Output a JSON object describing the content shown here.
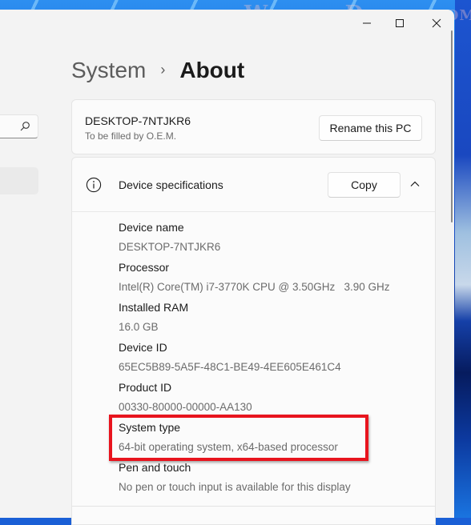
{
  "watermark": "WindowsDigital.com",
  "window": {
    "caption_buttons": [
      "minimize",
      "maximize",
      "close"
    ]
  },
  "sidebar": {
    "search_placeholder": ""
  },
  "breadcrumb": {
    "parent": "System",
    "separator": "›",
    "current": "About"
  },
  "pc_card": {
    "device_name": "DESKTOP-7NTJKR6",
    "model": "To be filled by O.E.M.",
    "rename_button": "Rename this PC"
  },
  "device_specifications": {
    "title": "Device specifications",
    "copy_button": "Copy",
    "expanded": true,
    "items": [
      {
        "label": "Device name",
        "value": "DESKTOP-7NTJKR6"
      },
      {
        "label": "Processor",
        "value": "Intel(R) Core(TM) i7-3770K CPU @ 3.50GHz   3.90 GHz"
      },
      {
        "label": "Installed RAM",
        "value": "16.0 GB"
      },
      {
        "label": "Device ID",
        "value": "65EC5B89-5A5F-48C1-BE49-4EE605E461C4"
      },
      {
        "label": "Product ID",
        "value": "00330-80000-00000-AA130"
      },
      {
        "label": "System type",
        "value": "64-bit operating system, x64-based processor"
      },
      {
        "label": "Pen and touch",
        "value": "No pen or touch input is available for this display"
      }
    ]
  },
  "annotation": {
    "highlighted_item": "System type",
    "color": "#e8141e"
  }
}
